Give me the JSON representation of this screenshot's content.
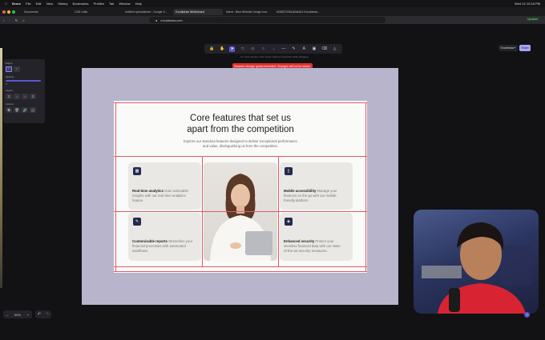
{
  "menubar": {
    "items": [
      "Brave",
      "File",
      "Edit",
      "View",
      "History",
      "Bookmarks",
      "Profiles",
      "Tab",
      "Window",
      "Help"
    ],
    "clock": "Wed 24 10:18 PM"
  },
  "tabs": [
    {
      "label": "Documents"
    },
    {
      "label": "CSS Units"
    },
    {
      "label": "Untitled spreadsheet - Google S..."
    },
    {
      "label": "Excalidraw Whiteboard"
    },
    {
      "label": "Intent - Best Website Design Inst..."
    },
    {
      "label": "6268373261dd3d4b2-Excalidraw..."
    }
  ],
  "address": {
    "url": "excalidraw.com",
    "profile_btn": "Updated"
  },
  "toolbar": {
    "tools": [
      "lock",
      "hand",
      "select",
      "rectangle",
      "diamond",
      "ellipse",
      "arrow",
      "line",
      "pencil",
      "text",
      "image",
      "eraser",
      "more"
    ],
    "selected_index": 2,
    "hint": "To move canvas, hold mouse wheel or spacebar while dragging",
    "warning": "Browser storage quota exceeded. Changes will not be saved.",
    "excalidraw_plus": "Excalidraw+",
    "share": "Share"
  },
  "panel": {
    "edges": "Edges",
    "opacity": "Opacity",
    "opacity_range": "0",
    "layers": "Layers",
    "actions": "Actions"
  },
  "slide": {
    "title_line1": "Core features that set us",
    "title_line2": "apart from the competition",
    "subtitle_line1": "Explore our standout features designed to deliver exceptional performance",
    "subtitle_line2": "and value, distinguishing us from the competition.",
    "features": [
      {
        "bold": "Real-time analytics",
        "rest": [
          " Gain actionable",
          "insights with our real-time analytics",
          "feature"
        ],
        "icon": "chart-icon"
      },
      {
        "bold": "Mobile accessibility",
        "rest": [
          " Manage your",
          "finances on the go with our mobile-",
          "friendly platform"
        ],
        "icon": "mobile-icon"
      },
      {
        "bold": "Customizable reports",
        "rest": [
          " Streamline your",
          "financial processes with automated",
          "workflows."
        ],
        "icon": "pencil-icon"
      },
      {
        "bold": "Enhanced security",
        "rest": [
          " Protect your",
          "sensitive financial data with our state-",
          "of-the-art security measures."
        ],
        "icon": "shield-icon"
      }
    ]
  },
  "zoom": {
    "value": "90%",
    "minus": "–",
    "plus": "+"
  },
  "colors": {
    "accent": "#5b57d1",
    "warning": "#e03131",
    "frame": "#b7b4cc",
    "icon_bg": "#252a4e"
  }
}
